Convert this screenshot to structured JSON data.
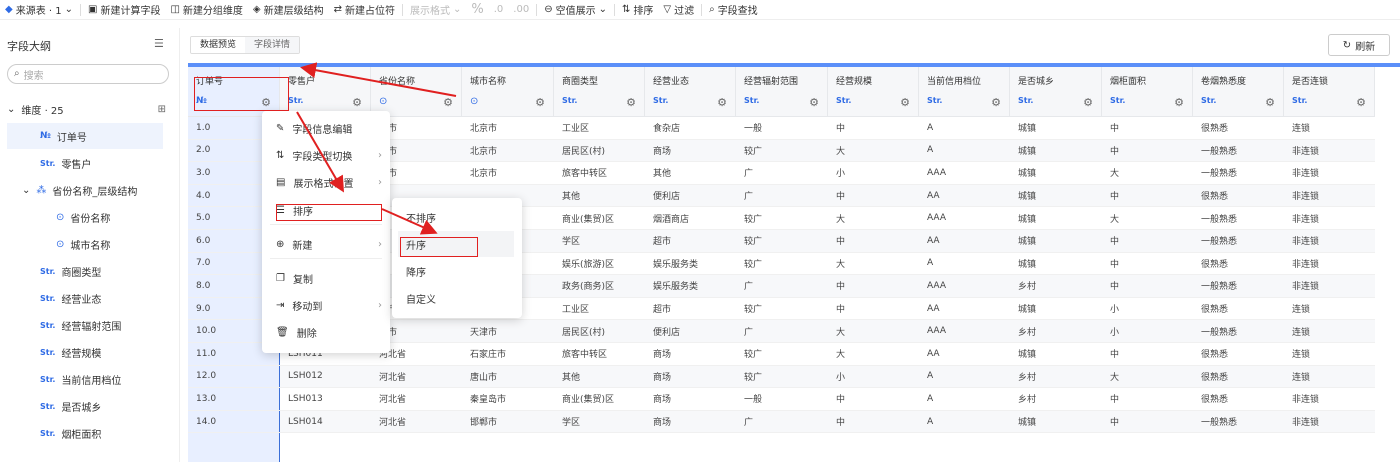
{
  "toolbar": {
    "source": "来源表 · 1",
    "new_calc": "新建计算字段",
    "new_group": "新建分组维度",
    "new_hier": "新建层级结构",
    "new_placeholder": "新建占位符",
    "display_format": "展示格式",
    "percent": "%",
    "dec_add": ".0",
    "dec_remove": ".00",
    "null_display": "空值展示",
    "sort": "排序",
    "filter": "过滤",
    "field_search": "字段查找"
  },
  "sidebar": {
    "title": "字段大纲",
    "search_placeholder": "搜索",
    "dimension_label": "维度 · 25",
    "items": [
      {
        "type": "№",
        "label": "订单号",
        "selected": true
      },
      {
        "type": "Str.",
        "label": "零售户"
      },
      {
        "type": "hier",
        "label": "省份名称_层级结构"
      },
      {
        "type": "geo",
        "label": "省份名称"
      },
      {
        "type": "geo",
        "label": "城市名称"
      },
      {
        "type": "Str.",
        "label": "商圈类型"
      },
      {
        "type": "Str.",
        "label": "经营业态"
      },
      {
        "type": "Str.",
        "label": "经营辐射范围"
      },
      {
        "type": "Str.",
        "label": "经营规模"
      },
      {
        "type": "Str.",
        "label": "当前信用档位"
      },
      {
        "type": "Str.",
        "label": "是否城乡"
      },
      {
        "type": "Str.",
        "label": "烟柜面积"
      }
    ]
  },
  "tabs": [
    "数据预览",
    "字段详情"
  ],
  "refresh_label": "刷新",
  "table": {
    "columns": [
      {
        "name": "订单号",
        "type": "№"
      },
      {
        "name": "零售户",
        "type": "Str."
      },
      {
        "name": "省份名称",
        "type": "geo"
      },
      {
        "name": "城市名称",
        "type": "geo"
      },
      {
        "name": "商圈类型",
        "type": "Str."
      },
      {
        "name": "经营业态",
        "type": "Str."
      },
      {
        "name": "经营辐射范围",
        "type": "Str."
      },
      {
        "name": "经营规模",
        "type": "Str."
      },
      {
        "name": "当前信用档位",
        "type": "Str."
      },
      {
        "name": "是否城乡",
        "type": "Str."
      },
      {
        "name": "烟柜面积",
        "type": "Str."
      },
      {
        "name": "卷烟熟悉度",
        "type": "Str."
      },
      {
        "name": "是否连锁",
        "type": "Str."
      }
    ],
    "rows": [
      [
        "1.0",
        "",
        "京市",
        "北京市",
        "工业区",
        "食杂店",
        "一般",
        "中",
        "A",
        "城镇",
        "中",
        "很熟悉",
        "连锁"
      ],
      [
        "2.0",
        "",
        "京市",
        "北京市",
        "居民区(村)",
        "商场",
        "较广",
        "大",
        "A",
        "城镇",
        "中",
        "一般熟悉",
        "非连锁"
      ],
      [
        "3.0",
        "",
        "京市",
        "北京市",
        "旅客中转区",
        "其他",
        "广",
        "小",
        "AAA",
        "城镇",
        "大",
        "一般熟悉",
        "非连锁"
      ],
      [
        "4.0",
        "",
        "",
        "",
        "其他",
        "便利店",
        "广",
        "中",
        "AA",
        "城镇",
        "中",
        "很熟悉",
        "非连锁"
      ],
      [
        "5.0",
        "",
        "",
        "",
        "商业(集贸)区",
        "烟酒商店",
        "较广",
        "大",
        "AAA",
        "城镇",
        "大",
        "一般熟悉",
        "非连锁"
      ],
      [
        "6.0",
        "",
        "",
        "",
        "学区",
        "超市",
        "较广",
        "中",
        "AA",
        "城镇",
        "中",
        "一般熟悉",
        "非连锁"
      ],
      [
        "7.0",
        "",
        "",
        "",
        "娱乐(旅游)区",
        "娱乐服务类",
        "较广",
        "大",
        "A",
        "城镇",
        "中",
        "很熟悉",
        "非连锁"
      ],
      [
        "8.0",
        "",
        "",
        "",
        "政务(商务)区",
        "娱乐服务类",
        "广",
        "中",
        "AAA",
        "乡村",
        "中",
        "一般熟悉",
        "非连锁"
      ],
      [
        "9.0",
        "",
        "津市",
        "天津市",
        "工业区",
        "超市",
        "较广",
        "中",
        "AA",
        "城镇",
        "小",
        "很熟悉",
        "连锁"
      ],
      [
        "10.0",
        "",
        "津市",
        "天津市",
        "居民区(村)",
        "便利店",
        "广",
        "大",
        "AAA",
        "乡村",
        "小",
        "一般熟悉",
        "连锁"
      ],
      [
        "11.0",
        "LSH011",
        "河北省",
        "石家庄市",
        "旅客中转区",
        "商场",
        "较广",
        "大",
        "AA",
        "城镇",
        "中",
        "很熟悉",
        "连锁"
      ],
      [
        "12.0",
        "LSH012",
        "河北省",
        "唐山市",
        "其他",
        "商场",
        "较广",
        "小",
        "A",
        "乡村",
        "大",
        "很熟悉",
        "连锁"
      ],
      [
        "13.0",
        "LSH013",
        "河北省",
        "秦皇岛市",
        "商业(集贸)区",
        "商场",
        "一般",
        "中",
        "A",
        "乡村",
        "中",
        "很熟悉",
        "非连锁"
      ],
      [
        "14.0",
        "LSH014",
        "河北省",
        "邯郸市",
        "学区",
        "商场",
        "广",
        "中",
        "A",
        "城镇",
        "中",
        "一般熟悉",
        "非连锁"
      ]
    ]
  },
  "context_menu": {
    "items": [
      {
        "icon": "edit-icon",
        "label": "字段信息编辑",
        "sub": false
      },
      {
        "icon": "switch-icon",
        "label": "字段类型切换",
        "sub": true
      },
      {
        "icon": "format-icon",
        "label": "展示格式设置",
        "sub": true
      },
      {
        "icon": "sort-icon",
        "label": "排序",
        "sub": false
      },
      {
        "icon": "plus-circle-icon",
        "label": "新建",
        "sub": true
      },
      {
        "icon": "copy-icon",
        "label": "复制",
        "sub": false
      },
      {
        "icon": "move-icon",
        "label": "移动到",
        "sub": true
      },
      {
        "icon": "trash-icon",
        "label": "删除",
        "sub": false
      }
    ]
  },
  "sort_submenu": {
    "items": [
      "不排序",
      "升序",
      "降序",
      "自定义"
    ]
  },
  "colors": {
    "accent": "#2f6be5",
    "annotation": "#e02020",
    "header_bar": "#5b8ff9"
  }
}
